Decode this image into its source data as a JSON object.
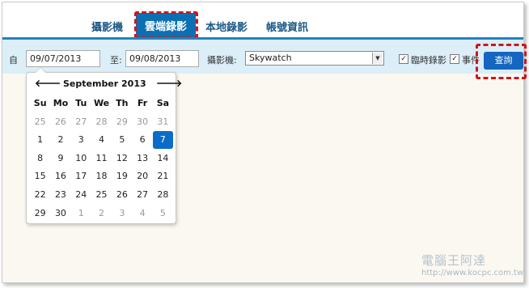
{
  "nav": {
    "tabs": [
      "攝影機",
      "雲端錄影",
      "本地錄影",
      "帳號資訊"
    ],
    "active": "雲端錄影"
  },
  "search": {
    "from_label": "自",
    "from_value": "09/07/2013",
    "to_label": "至:",
    "to_value": "09/08/2013",
    "camera_label": "攝影機:",
    "camera_value": "Skywatch",
    "temp_label": "臨時錄影",
    "temp_checked": true,
    "event_label": "事件",
    "event_checked": true,
    "query_label": "查詢"
  },
  "calendar": {
    "prev_icon": "arrow-left",
    "next_icon": "arrow-right",
    "month_title": "September 2013",
    "weekdays": [
      "Su",
      "Mo",
      "Tu",
      "We",
      "Th",
      "Fr",
      "Sa"
    ],
    "weeks": [
      [
        "25",
        "26",
        "27",
        "28",
        "29",
        "30",
        "31"
      ],
      [
        "1",
        "2",
        "3",
        "4",
        "5",
        "6",
        "7"
      ],
      [
        "8",
        "9",
        "10",
        "11",
        "12",
        "13",
        "14"
      ],
      [
        "15",
        "16",
        "17",
        "18",
        "19",
        "20",
        "21"
      ],
      [
        "22",
        "23",
        "24",
        "25",
        "26",
        "27",
        "28"
      ],
      [
        "29",
        "30",
        "1",
        "2",
        "3",
        "4",
        "5"
      ]
    ],
    "selected": "7"
  },
  "watermark": {
    "line1": "電腦王阿達",
    "line2": "http://www.kocpc.com.tw"
  },
  "colors": {
    "brand": "#0b6fb3",
    "highlight": "#d0151a",
    "toolbar_bg": "#dceef8",
    "page_bg": "#fbf8f1"
  }
}
